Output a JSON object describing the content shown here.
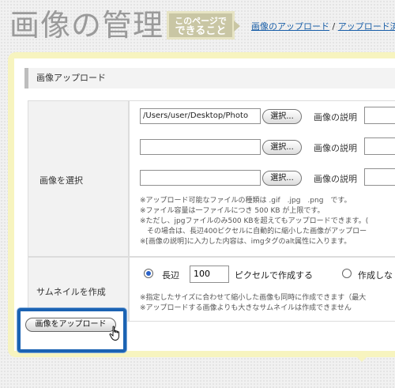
{
  "page_title": "画像の管理",
  "badge": {
    "line1": "このページで",
    "line2": "できること"
  },
  "topnav": {
    "link1": "画像のアップロード",
    "separator": " / ",
    "link2": "アップロード済"
  },
  "section_title": "画像アップロード",
  "select_row": {
    "label": "画像を選択",
    "files": [
      {
        "value": "/Users/user/Desktop/Photo",
        "button": "選択...",
        "desc_label": "画像の説明"
      },
      {
        "value": "",
        "button": "選択...",
        "desc_label": "画像の説明"
      },
      {
        "value": "",
        "button": "選択...",
        "desc_label": "画像の説明"
      }
    ],
    "notes": [
      "※アップロード可能なファイルの種類は .gif　.jpg　.png　です。",
      "※ファイル容量は一ファイルにつき 500 KB が上限です。",
      "※ただし、jpgファイルのみ500 KBを超えてもアップロードできます。(",
      "　その場合は、長辺400ピクセルに自動的に縮小した画像がアップロー",
      "※[画像の説明]に入力した内容は、imgタグのalt属性に入ります。"
    ]
  },
  "thumb_row": {
    "label": "サムネイルを作成",
    "option1_label": "長辺",
    "size_value": "100",
    "option1_suffix": "ピクセルで作成する",
    "option2_label": "作成しな",
    "notes": [
      "※指定したサイズに合わせて縮小した画像も同時に作成できます（最大",
      "※アップロードする画像よりも大きなサムネイルは作成できません"
    ]
  },
  "upload_button": "画像をアップロード",
  "colors": {
    "accent": "#1b63b3",
    "frame": "#f7f4bf",
    "link": "#1a5fa8"
  }
}
